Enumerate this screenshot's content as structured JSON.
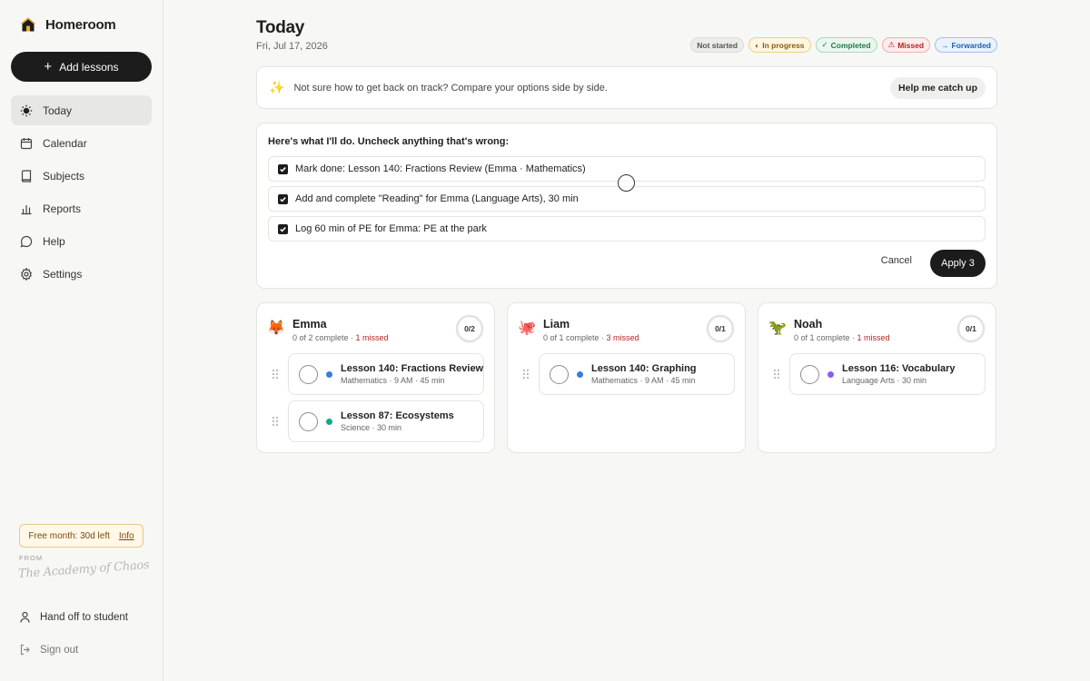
{
  "app": {
    "name": "Homeroom"
  },
  "sidebar": {
    "add_label": "Add lessons",
    "items": [
      {
        "label": "Today",
        "icon": "sun-icon",
        "active": true
      },
      {
        "label": "Calendar",
        "icon": "calendar-icon"
      },
      {
        "label": "Subjects",
        "icon": "book-icon"
      },
      {
        "label": "Reports",
        "icon": "bar-chart-icon"
      },
      {
        "label": "Help",
        "icon": "chat-bubble-icon"
      },
      {
        "label": "Settings",
        "icon": "gear-icon"
      }
    ],
    "trial": {
      "text": "Free month: 30d left",
      "link": "Info"
    },
    "from_label": "FROM",
    "signature": "The Academy of Chaos",
    "handoff_label": "Hand off to student",
    "signout_label": "Sign out"
  },
  "header": {
    "title": "Today",
    "date": "Fri, Jul 17, 2026",
    "legend": [
      {
        "label": "Not started",
        "icon": ""
      },
      {
        "label": "In progress",
        "icon": "◐"
      },
      {
        "label": "Completed",
        "icon": "✓"
      },
      {
        "label": "Missed",
        "icon": "⚠"
      },
      {
        "label": "Forwarded",
        "icon": "→"
      }
    ]
  },
  "tip": {
    "text": "Not sure how to get back on track? Compare your options side by side.",
    "button": "Help me catch up"
  },
  "plan": {
    "heading": "Here's what I'll do. Uncheck anything that's wrong:",
    "items": [
      {
        "label": "Mark done: Lesson 140: Fractions Review (Emma · Mathematics)",
        "checked": true
      },
      {
        "label": "Add and complete \"Reading\" for Emma (Language Arts), 30 min",
        "checked": true
      },
      {
        "label": "Log 60 min of PE for Emma: PE at the park",
        "checked": true
      }
    ],
    "cancel": "Cancel",
    "apply": "Apply 3"
  },
  "students": [
    {
      "name": "Emma",
      "emoji": "🦊",
      "progress_text": "0 of 2 complete · ",
      "missed_text": "1 missed",
      "ring": "0/2",
      "lessons": [
        {
          "title": "Lesson 140: Fractions Review",
          "meta": "Mathematics · 9 AM · 45 min",
          "color": "#3a7be0"
        },
        {
          "title": "Lesson 87: Ecosystems",
          "meta": "Science · 30 min",
          "color": "#18a58c"
        }
      ]
    },
    {
      "name": "Liam",
      "emoji": "🐙",
      "progress_text": "0 of 1 complete · ",
      "missed_text": "3 missed",
      "ring": "0/1",
      "lessons": [
        {
          "title": "Lesson 140: Graphing",
          "meta": "Mathematics · 9 AM · 45 min",
          "color": "#3a7be0"
        }
      ]
    },
    {
      "name": "Noah",
      "emoji": "🦖",
      "progress_text": "0 of 1 complete · ",
      "missed_text": "1 missed",
      "ring": "0/1",
      "lessons": [
        {
          "title": "Lesson 116: Vocabulary",
          "meta": "Language Arts · 30 min",
          "color": "#8b5cf6"
        }
      ]
    }
  ]
}
